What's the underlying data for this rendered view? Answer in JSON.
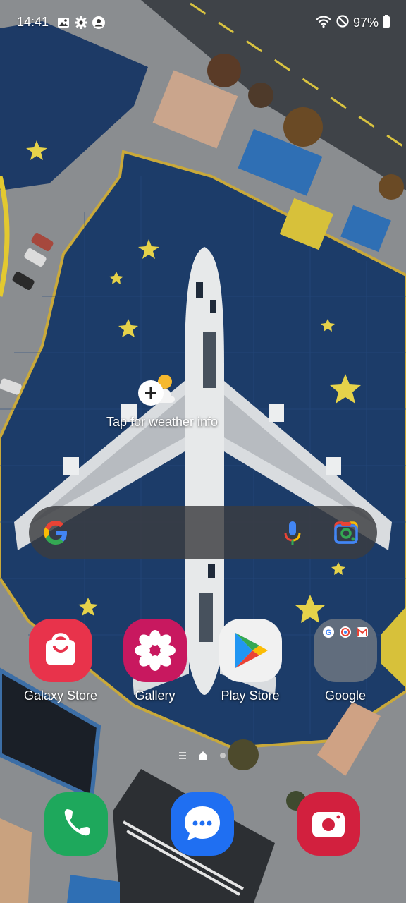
{
  "status_bar": {
    "time": "14:41",
    "battery_percent": "97%",
    "left_icons": [
      "gallery-notification-icon",
      "settings-notification-icon",
      "account-notification-icon"
    ],
    "right_icons": [
      "wifi-icon",
      "do-not-disturb-icon",
      "battery-icon"
    ]
  },
  "weather": {
    "label": "Tap for weather info",
    "icon": "weather-add-icon"
  },
  "search": {
    "logo": "google-g-icon",
    "voice": "mic-icon",
    "lens": "google-lens-icon"
  },
  "apps": [
    {
      "label": "Galaxy Store",
      "icon": "galaxy-store-icon",
      "color": "#e8334b"
    },
    {
      "label": "Gallery",
      "icon": "gallery-flower-icon",
      "color": "#c8185f"
    },
    {
      "label": "Play Store",
      "icon": "play-store-icon",
      "color": "#f1f1f1"
    },
    {
      "label": "Google",
      "icon": "google-folder-icon",
      "color": "#6b6f75"
    }
  ],
  "page_indicator": {
    "pages": 2,
    "current": 1,
    "icons": [
      "menu-lines-icon",
      "home-page-icon",
      "page-dot-icon"
    ]
  },
  "dock": [
    {
      "name": "phone",
      "icon": "phone-icon",
      "color": "#1ea85c"
    },
    {
      "name": "messages",
      "icon": "messages-icon",
      "color": "#1f6ff2"
    },
    {
      "name": "camera",
      "icon": "camera-icon",
      "color": "#d2203e"
    }
  ]
}
